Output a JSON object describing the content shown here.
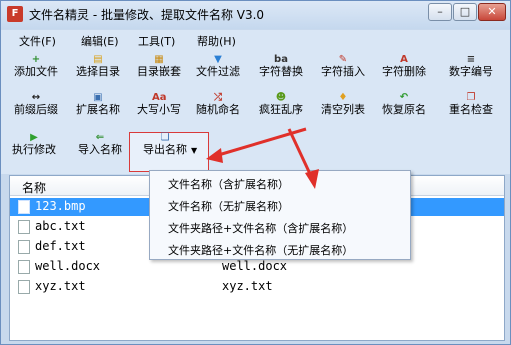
{
  "window": {
    "title": "文件名精灵 - 批量修改、提取文件名称 V3.0",
    "minimize_label": "–",
    "maximize_label": "□",
    "close_label": "✕"
  },
  "menubar": {
    "items": [
      {
        "label": "文件(F)"
      },
      {
        "label": "编辑(E)"
      },
      {
        "label": "工具(T)"
      },
      {
        "label": "帮助(H)"
      }
    ]
  },
  "toolbar": {
    "rows": [
      [
        {
          "label": "添加文件",
          "icon": "add-file-icon",
          "glyph": "+",
          "color": "#2f8f2f"
        },
        {
          "label": "选择目录",
          "icon": "folder-icon",
          "glyph": "▤",
          "color": "#d9a017"
        },
        {
          "label": "目录嵌套",
          "icon": "nested-folder-icon",
          "glyph": "▦",
          "color": "#c98a10"
        },
        {
          "label": "文件过滤",
          "icon": "filter-icon",
          "glyph": "▼",
          "color": "#2a7fd4"
        },
        {
          "label": "字符替换",
          "icon": "replace-icon",
          "glyph": "ba",
          "color": "#333333"
        },
        {
          "label": "字符插入",
          "icon": "insert-icon",
          "glyph": "✎",
          "color": "#c0392b"
        },
        {
          "label": "字符删除",
          "icon": "delete-char-icon",
          "glyph": "A",
          "color": "#c0392b"
        },
        {
          "label": "数字编号",
          "icon": "numbering-icon",
          "glyph": "≡",
          "color": "#333333"
        }
      ],
      [
        {
          "label": "前缀后缀",
          "icon": "prefix-suffix-icon",
          "glyph": "↔",
          "color": "#222222"
        },
        {
          "label": "扩展名称",
          "icon": "extension-icon",
          "glyph": "▣",
          "color": "#3a6fb0"
        },
        {
          "label": "大写小写",
          "icon": "case-icon",
          "glyph": "Aa",
          "color": "#c0392b"
        },
        {
          "label": "随机命名",
          "icon": "random-icon",
          "glyph": "⤮",
          "color": "#c0392b"
        },
        {
          "label": "疯狂乱序",
          "icon": "shuffle-icon",
          "glyph": "☻",
          "color": "#5a9a1a"
        },
        {
          "label": "清空列表",
          "icon": "clear-list-icon",
          "glyph": "♦",
          "color": "#e0a020"
        },
        {
          "label": "恢复原名",
          "icon": "restore-icon",
          "glyph": "↶",
          "color": "#2f9a2f"
        },
        {
          "label": "重名检查",
          "icon": "duplicate-check-icon",
          "glyph": "❐",
          "color": "#c0392b"
        }
      ],
      [
        {
          "label": "执行修改",
          "icon": "run-icon",
          "glyph": "▶",
          "color": "#2fa02f"
        },
        {
          "label": "导入名称",
          "icon": "import-icon",
          "glyph": "⇐",
          "color": "#2f8f2f"
        },
        {
          "label": "导出名称",
          "icon": "export-icon",
          "glyph": "❏",
          "color": "#3a6fb0"
        }
      ]
    ]
  },
  "list": {
    "header": "名称",
    "rows": [
      {
        "name": "123.bmp",
        "new_name": "",
        "selected": true
      },
      {
        "name": "abc.txt",
        "new_name": "",
        "selected": false
      },
      {
        "name": "def.txt",
        "new_name": "",
        "selected": false
      },
      {
        "name": "well.docx",
        "new_name": "well.docx",
        "selected": false
      },
      {
        "name": "xyz.txt",
        "new_name": "xyz.txt",
        "selected": false
      }
    ]
  },
  "export_menu": {
    "items": [
      "文件名称（含扩展名称）",
      "文件名称（无扩展名称）",
      "文件夹路径+文件名称（含扩展名称）",
      "文件夹路径+文件名称（无扩展名称）"
    ]
  },
  "colors": {
    "selection": "#3399ff",
    "highlight": "#d93a3a",
    "window_frame": "#c8d9ed"
  }
}
